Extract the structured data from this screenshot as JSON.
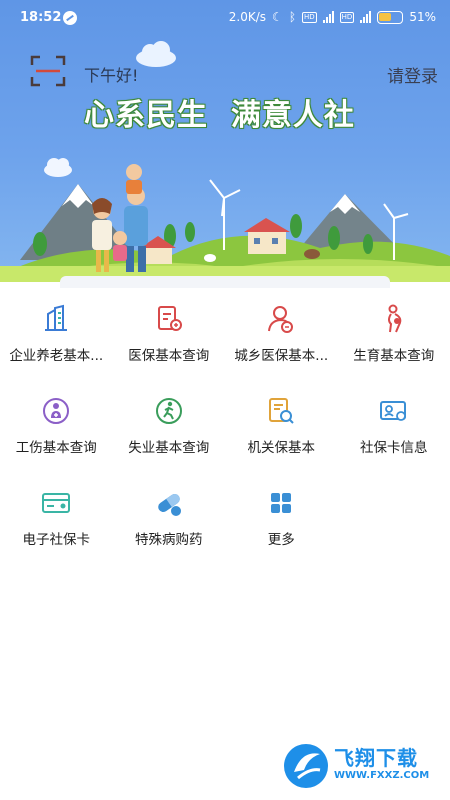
{
  "status_bar": {
    "time": "18:52",
    "network_speed": "2.0K/s",
    "battery": "51%"
  },
  "header": {
    "greeting": "下午好!",
    "login_label": "请登录",
    "slogan": "心系民生  满意人社"
  },
  "services": [
    {
      "label": "企业养老基本...",
      "icon": "building-icon",
      "color": "#3a7bd5"
    },
    {
      "label": "医保基本查询",
      "icon": "medical-insurance-icon",
      "color": "#d84a4a"
    },
    {
      "label": "城乡医保基本...",
      "icon": "person-badge-icon",
      "color": "#d84a4a"
    },
    {
      "label": "生育基本查询",
      "icon": "pregnancy-icon",
      "color": "#d84a4a"
    },
    {
      "label": "工伤基本查询",
      "icon": "injury-icon",
      "color": "#8b5fc7"
    },
    {
      "label": "失业基本查询",
      "icon": "running-person-icon",
      "color": "#3a9d5b"
    },
    {
      "label": "机关保基本",
      "icon": "document-search-icon",
      "color": "#e0a33a"
    },
    {
      "label": "社保卡信息",
      "icon": "id-card-icon",
      "color": "#3a8fd5"
    },
    {
      "label": "电子社保卡",
      "icon": "e-card-icon",
      "color": "#3ab5a5"
    },
    {
      "label": "特殊病购药",
      "icon": "pill-icon",
      "color": "#3a8fd5"
    },
    {
      "label": "更多",
      "icon": "grid-more-icon",
      "color": "#3a8fd5"
    }
  ],
  "watermark": {
    "brand": "飞翔下载",
    "url": "WWW.FXXZ.COM"
  }
}
